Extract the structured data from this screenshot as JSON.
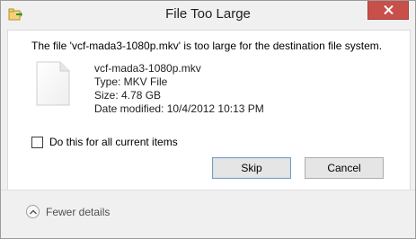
{
  "window": {
    "title": "File Too Large"
  },
  "dialog": {
    "message": "The file 'vcf-mada3-1080p.mkv' is too large for the destination file system.",
    "file": {
      "name": "vcf-mada3-1080p.mkv",
      "type": "Type: MKV File",
      "size": "Size: 4.78 GB",
      "date_modified": "Date modified: 10/4/2012 10:13 PM"
    },
    "apply_to_all": {
      "label": "Do this for all current items",
      "checked": false
    },
    "buttons": {
      "skip": "Skip",
      "cancel": "Cancel"
    },
    "footer": {
      "details_label": "Fewer details"
    }
  },
  "colors": {
    "close_button": "#c7504a",
    "window_bg": "#f0f0f0",
    "content_bg": "#ffffff"
  },
  "icons": {
    "title": "file-move-icon",
    "file": "blank-file-icon",
    "close": "close-icon",
    "details": "chevron-up-icon"
  }
}
